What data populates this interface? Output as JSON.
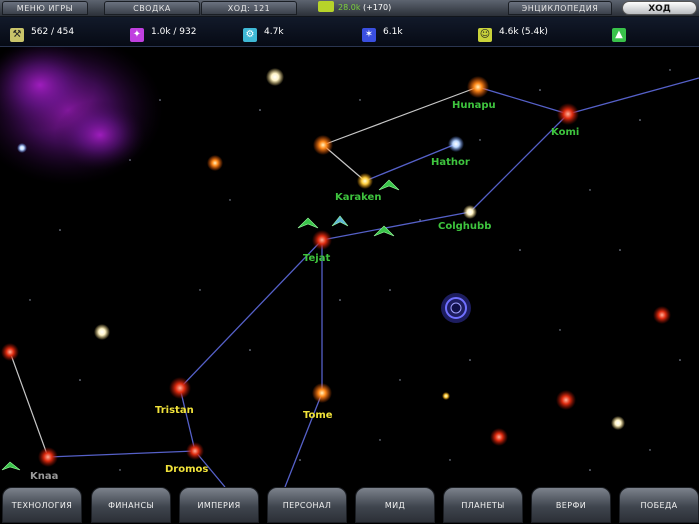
{
  "topbar": {
    "game_menu": "МЕНЮ ИГРЫ",
    "summary": "СВОДКА",
    "turn": "ХОД: 121",
    "credits": "28.0k",
    "credits_delta": "(+170)",
    "encyclopedia": "ЭНЦИКЛОПЕДИЯ",
    "end_turn": "ХОД"
  },
  "resources": [
    {
      "icon": "industry-icon",
      "value": "562 / 454",
      "color": "#c9c46a"
    },
    {
      "icon": "research-icon",
      "value": "1.0k / 932",
      "color": "#c040e0"
    },
    {
      "icon": "trade-icon",
      "value": "4.7k",
      "color": "#3fb9d6"
    },
    {
      "icon": "influence-icon",
      "value": "6.1k",
      "color": "#3a4fe0"
    },
    {
      "icon": "approval-icon",
      "value": "4.6k (5.4k)",
      "color": "#c9d23a"
    },
    {
      "icon": "fleet-icon",
      "value": "",
      "color": "#39c24a"
    }
  ],
  "systems": [
    {
      "name": "Hunapu",
      "color": "#3ec43e"
    },
    {
      "name": "Komi",
      "color": "#3ec43e"
    },
    {
      "name": "Hathor",
      "color": "#3ec43e"
    },
    {
      "name": "Karaken",
      "color": "#3ec43e"
    },
    {
      "name": "Colghubb",
      "color": "#3ec43e"
    },
    {
      "name": "Tejat",
      "color": "#3ec43e"
    },
    {
      "name": "Tristan",
      "color": "#f0e23a"
    },
    {
      "name": "Tome",
      "color": "#f0e23a"
    },
    {
      "name": "Dromos",
      "color": "#f0e23a"
    },
    {
      "name": "Knaa",
      "color": "#9a9a9a"
    }
  ],
  "bottom": {
    "tech": "ТЕХНОЛОГИЯ",
    "finance": "ФИНАНСЫ",
    "empire": "ИМПЕРИЯ",
    "personnel": "ПЕРСОНАЛ",
    "mid": "МИД",
    "planets": "ПЛАНЕТЫ",
    "shipyards": "ВЕРФИ",
    "victory": "ПОБЕДА"
  }
}
